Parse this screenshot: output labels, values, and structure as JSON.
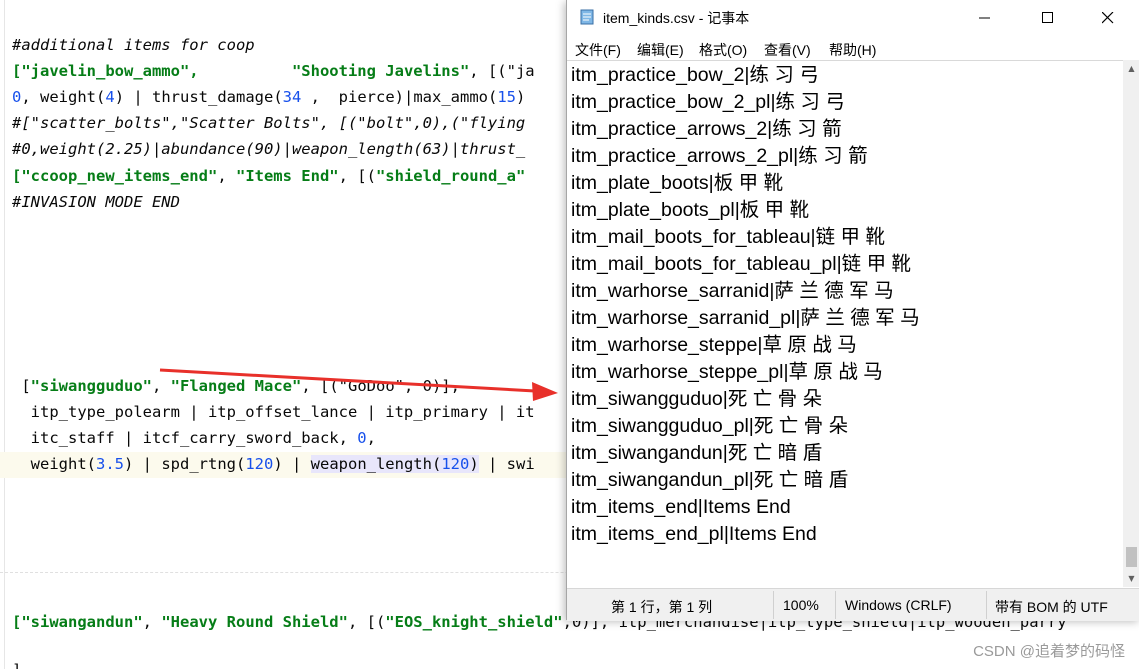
{
  "editor": {
    "lines": {
      "l1": "#additional items for coop",
      "l2a": "[\"javelin_bow_ammo\",",
      "l2b": "\"Shooting Javelins\"",
      "l2c": ", [(\"ja",
      "l3a": "0",
      "l3b": ", weight(",
      "l3c": "4",
      "l3d": ") | thrust_damage(",
      "l3e": "34",
      "l3f": " ,  pierce)|max_ammo(",
      "l3g": "15",
      "l3h": ")",
      "l4": "#[\"scatter_bolts\",\"Scatter Bolts\", [(\"bolt\",0),(\"flying",
      "l5": "#0,weight(2.25)|abundance(90)|weapon_length(63)|thrust_",
      "l6a": "[\"ccoop_new_items_end\"",
      "l6b": ", ",
      "l6c": "\"Items End\"",
      "l6d": ", [(",
      "l6e": "\"shield_round_a\"",
      "l7": "#INVASION MODE END",
      "l8a": " [",
      "l8b": "\"siwangguduo\"",
      "l8c": ", ",
      "l8d": "\"Flanged Mace\"",
      "l8e": ", [(\"GoDoo\", 0)],",
      "l9": "  itp_type_polearm | itp_offset_lance | itp_primary | it",
      "l10a": "  itc_staff | itcf_carry_sword_back, ",
      "l10b": "0",
      "l10c": ",",
      "l11a": "  weight(",
      "l11b": "3.5",
      "l11c": ") | spd_rtng(",
      "l11d": "120",
      "l11e": ") | ",
      "l11f": "weapon_length(",
      "l11g": "120",
      "l11h": ")",
      "l11i": " | swi",
      "l12a": "[\"siwangandun\"",
      "l12b": ", ",
      "l12c": "\"Heavy Round Shield\"",
      "l12d": ", [(",
      "l12e": "\"EOS_knight_shield\"",
      "l12f": ",0)], itp_merchandise|itp_type_shield|itp_wooden_parry",
      "l13": "]"
    }
  },
  "notepad": {
    "title": "item_kinds.csv - 记事本",
    "menu": [
      "文件(F)",
      "编辑(E)",
      "格式(O)",
      "查看(V)",
      "帮助(H)"
    ],
    "lines": [
      "itm_practice_bow_2|练 习 弓",
      "itm_practice_bow_2_pl|练 习 弓",
      "itm_practice_arrows_2|练 习 箭",
      "itm_practice_arrows_2_pl|练 习 箭",
      "itm_plate_boots|板 甲 靴",
      "itm_plate_boots_pl|板 甲 靴",
      "itm_mail_boots_for_tableau|链 甲 靴",
      "itm_mail_boots_for_tableau_pl|链 甲 靴",
      "itm_warhorse_sarranid|萨 兰 德 军 马",
      "itm_warhorse_sarranid_pl|萨 兰 德 军 马",
      "itm_warhorse_steppe|草 原 战 马",
      "itm_warhorse_steppe_pl|草 原 战 马",
      "itm_siwangguduo|死 亡 骨 朵",
      "itm_siwangguduo_pl|死 亡 骨 朵",
      "itm_siwangandun|死 亡 暗 盾",
      "itm_siwangandun_pl|死 亡 暗 盾",
      "itm_items_end|Items End",
      "itm_items_end_pl|Items End"
    ],
    "status": {
      "position": "第 1 行，第 1 列",
      "zoom": "100%",
      "line_ending": "Windows (CRLF)",
      "encoding": "带有 BOM 的 UTF"
    }
  },
  "watermark": "CSDN @追着梦的码怪",
  "colors": {
    "arrow": "#e8302a",
    "string": "#067d17",
    "number": "#1750eb",
    "comment": "#8c8c8c"
  }
}
